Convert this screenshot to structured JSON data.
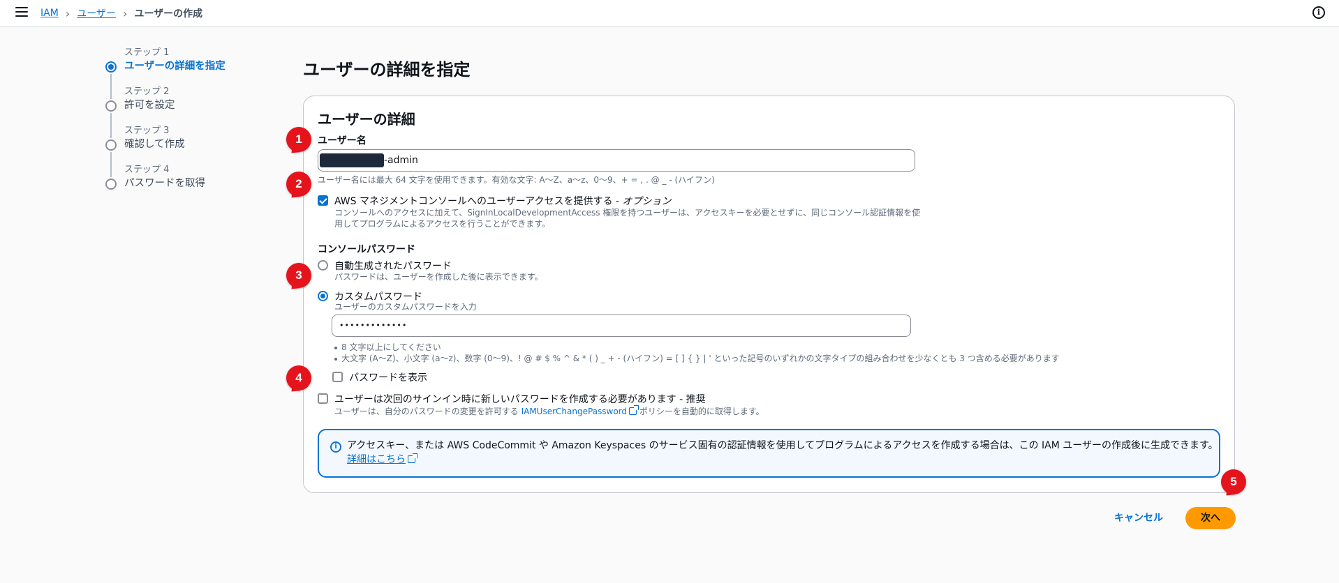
{
  "breadcrumb": [
    "IAM",
    "ユーザー",
    "ユーザーの作成"
  ],
  "steps": [
    {
      "num": "ステップ 1",
      "title": "ユーザーの詳細を指定",
      "active": true
    },
    {
      "num": "ステップ 2",
      "title": "許可を設定"
    },
    {
      "num": "ステップ 3",
      "title": "確認して作成"
    },
    {
      "num": "ステップ 4",
      "title": "パスワードを取得"
    }
  ],
  "page_title": "ユーザーの詳細を指定",
  "panel": {
    "title": "ユーザーの詳細",
    "username_label": "ユーザー名",
    "username_value_suffix": "-admin",
    "username_hint": "ユーザー名には最大 64 文字を使用できます。有効な文字: A〜Z、a〜z、0〜9、+ = , . @ _ - (ハイフン)",
    "console_access_label": "AWS マネジメントコンソールへのユーザーアクセスを提供する - ",
    "console_access_label_opt": "オプション",
    "console_access_desc1": "コンソールへのアクセスに加えて、SignInLocalDevelopmentAccess 権限を持つユーザーは、アクセスキーを必要とせずに、同じコンソール認証情報を使",
    "console_access_desc2": "用してプログラムによるアクセスを行うことができます。",
    "console_password_label": "コンソールパスワード",
    "auto_pw_label": "自動生成されたパスワード",
    "auto_pw_hint": "パスワードは、ユーザーを作成した後に表示できます。",
    "custom_pw_label": "カスタムパスワード",
    "custom_pw_hint": "ユーザーのカスタムパスワードを入力",
    "custom_pw_value": "•••••••••••••",
    "pw_rules": [
      "8 文字以上にしてください",
      "大文字 (A〜Z)、小文字 (a〜z)、数字 (0〜9)、! @ # $ % ^ & * ( ) _ + - (ハイフン) = [ ] { } | ' といった記号のいずれかの文字タイプの組み合わせを少なくとも 3 つ含める必要があります"
    ],
    "show_pw_label": "パスワードを表示",
    "reset_label": "ユーザーは次回のサインイン時に新しいパスワードを作成する必要があります - 推奨",
    "reset_hint_pre": "ユーザーは、自分のパスワードの変更を許可する ",
    "reset_hint_link": "IAMUserChangePassword",
    "reset_hint_post": " ポリシーを自動的に取得します。",
    "alert_text": "アクセスキー、または AWS CodeCommit や Amazon Keyspaces のサービス固有の認証情報を使用してプログラムによるアクセスを作成する場合は、この IAM ユーザーの作成後に生成できます。",
    "alert_link": "詳細はこちら"
  },
  "buttons": {
    "cancel": "キャンセル",
    "next": "次へ"
  },
  "badges": [
    "1",
    "2",
    "3",
    "4",
    "5"
  ],
  "colors": {
    "accent": "#0972d3",
    "primary_button": "#ff9900",
    "badge": "#e5141c"
  }
}
